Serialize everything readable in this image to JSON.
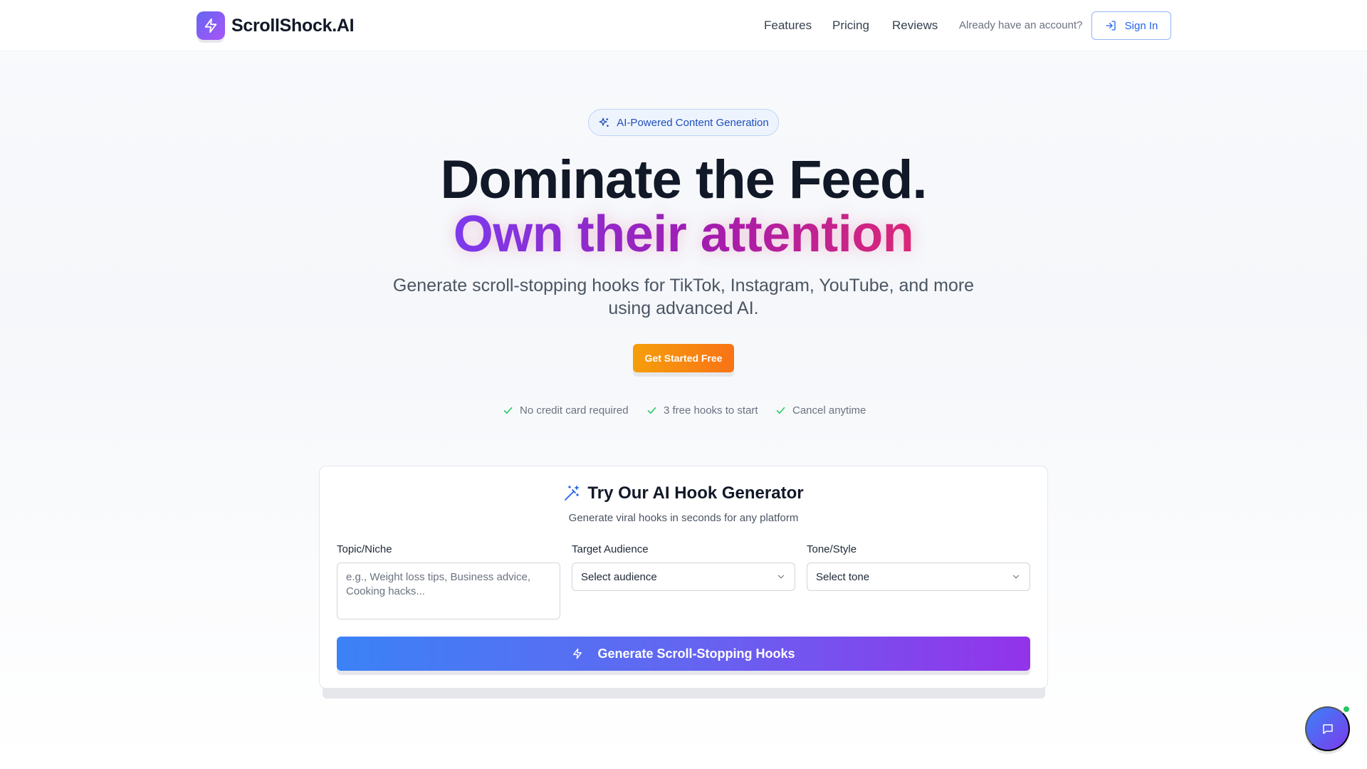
{
  "brand": {
    "name": "ScrollShock.AI"
  },
  "nav": {
    "links": [
      "Features",
      "Pricing",
      "Reviews"
    ],
    "account_text": "Already have an account?",
    "signin_label": "Sign In"
  },
  "hero": {
    "badge": "AI-Powered Content Generation",
    "title_line1": "Dominate the Feed.",
    "title_line2": "Own their attention",
    "subtitle_line1": "Generate scroll-stopping hooks for TikTok, Instagram, YouTube, and more",
    "subtitle_line2": "using advanced AI.",
    "cta_label": "Get Started Free",
    "perks": [
      "No credit card required",
      "3 free hooks to start",
      "Cancel anytime"
    ]
  },
  "generator": {
    "title": "Try Our AI Hook Generator",
    "subtitle": "Generate viral hooks in seconds for any platform",
    "topic_label": "Topic/Niche",
    "topic_placeholder": "e.g., Weight loss tips, Business advice, Cooking hacks...",
    "audience_label": "Target Audience",
    "audience_value": "Select audience",
    "tone_label": "Tone/Style",
    "tone_value": "Select tone",
    "generate_label": "Generate Scroll-Stopping Hooks"
  },
  "colors": {
    "primary_blue": "#2563eb",
    "gradient_purple": "#7c3aed",
    "gradient_pink": "#db2777",
    "cta_orange": "#f97316",
    "check_green": "#22c55e"
  },
  "icons": {
    "brand": "lightning-icon",
    "signin": "sign-in-icon",
    "badge": "sparkles-icon",
    "perk": "check-icon",
    "generator": "magic-wand-icon",
    "generate": "lightning-icon",
    "chat": "chat-icon"
  }
}
